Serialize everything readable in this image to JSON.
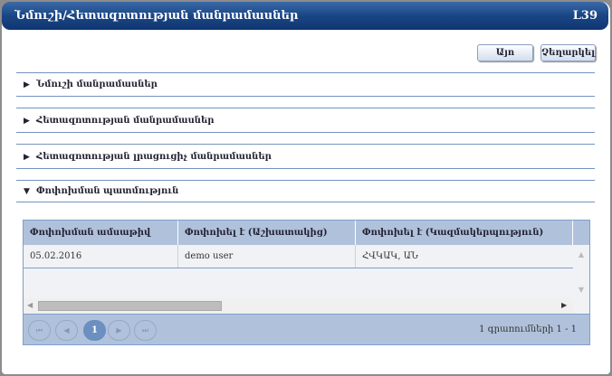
{
  "header": {
    "title": "Նմուշի/Հետազոտության մանրամասներ",
    "code": "L39"
  },
  "buttons": {
    "yes": "Այո",
    "cancel": "Չեղարկել"
  },
  "sections": [
    {
      "label": "Նմուշի մանրամասներ",
      "icon": "▶",
      "expanded": false
    },
    {
      "label": "Հետազոտության մանրամասներ",
      "icon": "▶",
      "expanded": false
    },
    {
      "label": "Հետազոտության լրացուցիչ մանրամասներ",
      "icon": "▶",
      "expanded": false
    },
    {
      "label": "Փոփոխման պատմություն",
      "icon": "▼",
      "expanded": true
    }
  ],
  "grid": {
    "columns": [
      "Փոփոխման ամսաթիվ",
      "Փոփոխել է (Աշխատակից)",
      "Փոփոխել է (Կազմակերպություն)"
    ],
    "rows": [
      [
        "05.02.2016",
        "demo user",
        "ՀՎԿԱԿ, ԱՆ"
      ]
    ]
  },
  "pager": {
    "first": "⏮",
    "prev": "◀",
    "page": "1",
    "next": "▶",
    "last": "⏭",
    "info": "1 գրառումների 1 - 1"
  }
}
